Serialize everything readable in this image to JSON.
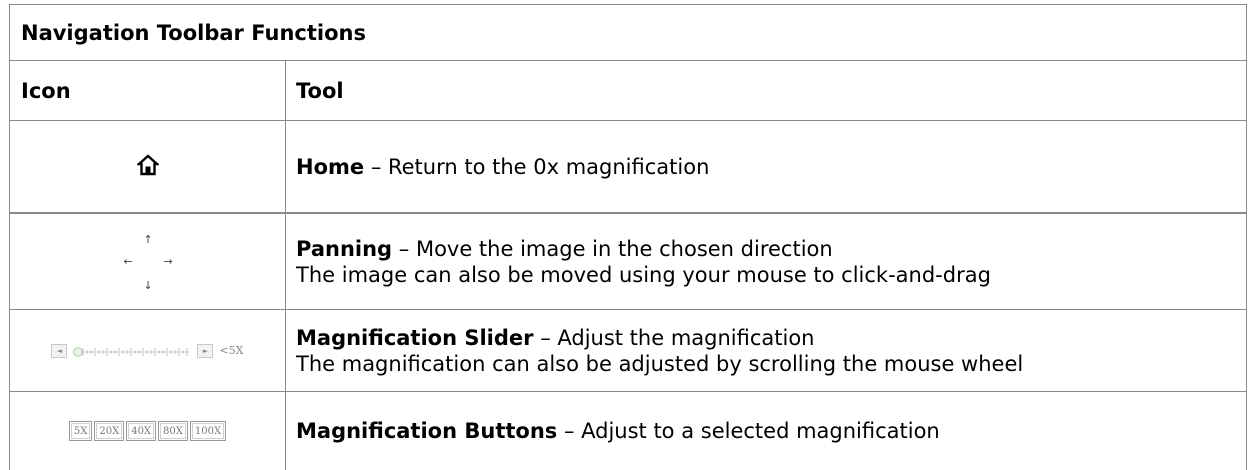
{
  "table": {
    "title": "Navigation Toolbar Functions",
    "headers": {
      "icon": "Icon",
      "tool": "Tool"
    },
    "rows": [
      {
        "icon": "home-icon",
        "name": "Home",
        "desc": " – Return to the 0x magnification",
        "desc2": ""
      },
      {
        "icon": "pan-arrows-icon",
        "name": "Panning",
        "desc": " – Move the image in the chosen direction",
        "desc2": "The image can also be moved using your mouse to click-and-drag"
      },
      {
        "icon": "magnification-slider-icon",
        "name": "Magnification Slider",
        "desc": " – Adjust the magnification",
        "desc2": "The magnification can also be adjusted by scrolling the mouse wheel"
      },
      {
        "icon": "magnification-buttons-icon",
        "name": "Magnification Buttons",
        "desc": " – Adjust to a selected magnification",
        "desc2": ""
      }
    ]
  },
  "pan_glyphs": {
    "up": "↑",
    "left": "←",
    "right": "→",
    "down": "↓"
  },
  "slider": {
    "left_btn": "◄",
    "right_btn": "►",
    "label": "<5X",
    "level": 0
  },
  "mag_buttons": [
    "5X",
    "20X",
    "40X",
    "80X",
    "100X"
  ]
}
